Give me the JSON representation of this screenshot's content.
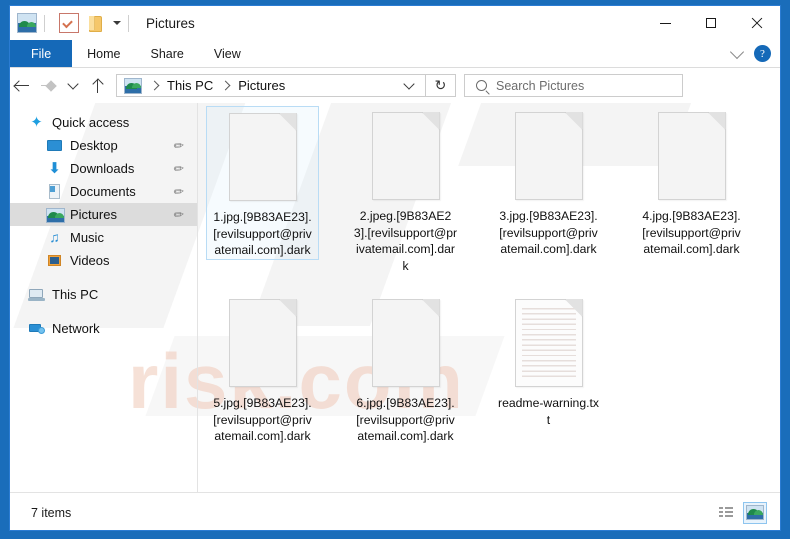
{
  "window": {
    "title": "Pictures",
    "titlebar_icons": [
      "picture-icon",
      "properties-icon",
      "folder-icon",
      "quick-access-caret"
    ],
    "controls": {
      "minimize": "minimize-button",
      "maximize": "maximize-button",
      "close": "close-button"
    },
    "frame_color": "#1A6DBA"
  },
  "ribbon": {
    "tabs": [
      {
        "label": "File",
        "active": true
      },
      {
        "label": "Home",
        "active": false
      },
      {
        "label": "Share",
        "active": false
      },
      {
        "label": "View",
        "active": false
      }
    ],
    "collapse_icon": "chevron-down-icon",
    "help_label": "?",
    "accent_color": "#1569b8"
  },
  "addressbar": {
    "back": "back-arrow-icon",
    "forward": "forward-arrow-icon",
    "recent": "chevron-down-icon",
    "up": "up-arrow-icon",
    "breadcrumb": [
      "This PC",
      "Pictures"
    ],
    "breadcrumb_icon": "picture-icon",
    "dropdown": "chevron-down-icon",
    "refresh": "↻",
    "search": {
      "placeholder": "Search Pictures",
      "value": ""
    }
  },
  "sidebar": {
    "items": [
      {
        "label": "Quick access",
        "icon": "star-icon",
        "level": 0,
        "pin": false,
        "selected": false
      },
      {
        "label": "Desktop",
        "icon": "desktop-icon",
        "level": 1,
        "pin": true,
        "selected": false
      },
      {
        "label": "Downloads",
        "icon": "download-icon",
        "level": 1,
        "pin": true,
        "selected": false
      },
      {
        "label": "Documents",
        "icon": "document-icon",
        "level": 1,
        "pin": true,
        "selected": false
      },
      {
        "label": "Pictures",
        "icon": "picture-icon",
        "level": 1,
        "pin": true,
        "selected": true
      },
      {
        "label": "Music",
        "icon": "music-icon",
        "level": 1,
        "pin": false,
        "selected": false
      },
      {
        "label": "Videos",
        "icon": "video-icon",
        "level": 1,
        "pin": false,
        "selected": false
      },
      {
        "label": "This PC",
        "icon": "computer-icon",
        "level": 0,
        "pin": false,
        "selected": false
      },
      {
        "label": "Network",
        "icon": "network-icon",
        "level": 0,
        "pin": false,
        "selected": false
      }
    ],
    "pin_glyph": "✐"
  },
  "files": [
    {
      "name": "1.jpg.[9B83AE23].[revilsupport@privatemail.com].dark",
      "icon": "blank-file-icon",
      "selected": true
    },
    {
      "name": "2.jpeg.[9B83AE23].[revilsupport@privatemail.com].dark",
      "icon": "blank-file-icon",
      "selected": false
    },
    {
      "name": "3.jpg.[9B83AE23].[revilsupport@privatemail.com].dark",
      "icon": "blank-file-icon",
      "selected": false
    },
    {
      "name": "4.jpg.[9B83AE23].[revilsupport@privatemail.com].dark",
      "icon": "blank-file-icon",
      "selected": false
    },
    {
      "name": "5.jpg.[9B83AE23].[revilsupport@privatemail.com].dark",
      "icon": "blank-file-icon",
      "selected": false
    },
    {
      "name": "6.jpg.[9B83AE23].[revilsupport@privatemail.com].dark",
      "icon": "blank-file-icon",
      "selected": false
    },
    {
      "name": "readme-warning.txt",
      "icon": "text-file-icon",
      "selected": false
    }
  ],
  "statusbar": {
    "item_count": "7 items",
    "views": [
      {
        "name": "details-view",
        "active": false
      },
      {
        "name": "large-icons-view",
        "active": true
      }
    ]
  },
  "watermark": {
    "text": "risk.com",
    "color": "#f0c9b8"
  }
}
